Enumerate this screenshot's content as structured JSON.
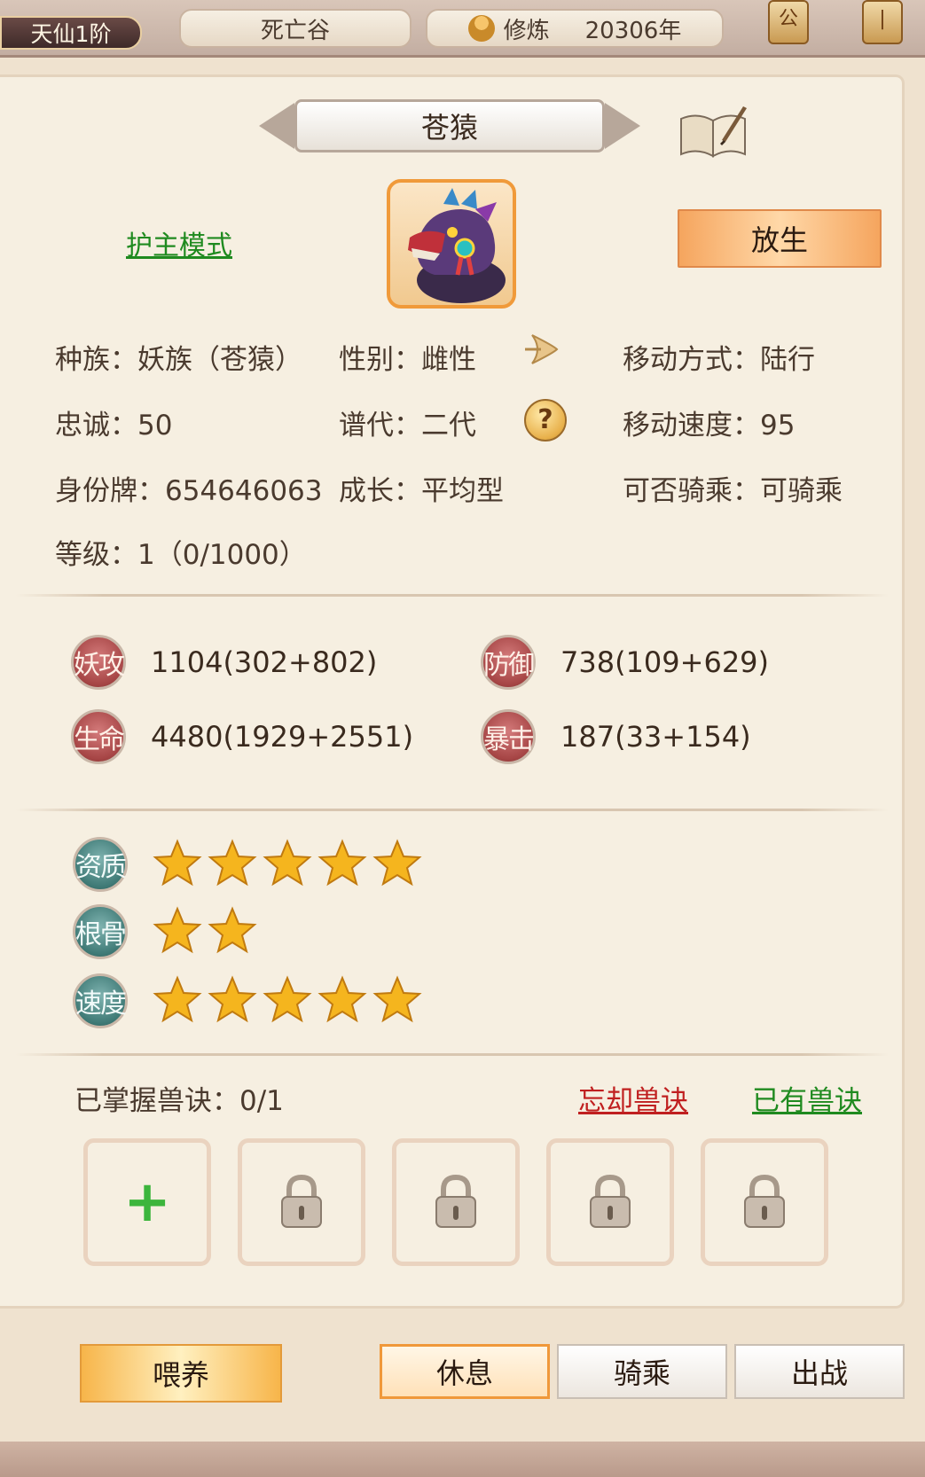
{
  "top_bar": {
    "realm": "天仙1阶",
    "location": "死亡谷",
    "cultivation_label": "修炼",
    "cultivation_years": "20306年",
    "lantern_1": "公",
    "lantern_2": "|"
  },
  "pet": {
    "name": "苍猿",
    "guard_mode_link": "护主模式",
    "release_button": "放生"
  },
  "info": {
    "race": "种族：妖族（苍猿）",
    "gender": "性别：雌性",
    "move_mode": "移动方式：陆行",
    "loyalty": "忠诚：50",
    "generation": "谱代：二代",
    "move_speed": "移动速度：95",
    "id_tag": "身份牌：654646063",
    "growth": "成长：平均型",
    "rideable": "可否骑乘：可骑乘",
    "level": "等级：1（0/1000）"
  },
  "stats": [
    {
      "label": "妖攻",
      "value": "1104(302+802)"
    },
    {
      "label": "防御",
      "value": "738(109+629)"
    },
    {
      "label": "生命",
      "value": "4480(1929+2551)"
    },
    {
      "label": "暴击",
      "value": "187(33+154)"
    }
  ],
  "attributes": [
    {
      "label": "资质",
      "stars": 5
    },
    {
      "label": "根骨",
      "stars": 2
    },
    {
      "label": "速度",
      "stars": 5
    }
  ],
  "skills": {
    "mastered_label": "已掌握兽诀：0/1",
    "forget_link": "忘却兽诀",
    "owned_link": "已有兽诀",
    "slots": [
      "add",
      "locked",
      "locked",
      "locked",
      "locked"
    ]
  },
  "actions": {
    "feed": "喂养",
    "rest": "休息",
    "ride": "骑乘",
    "battle": "出战",
    "active_mode": "rest"
  },
  "colors": {
    "link_green": "#1f8a1f",
    "link_red": "#c02020",
    "accent_orange": "#f0983a",
    "stat_badge": "#a64545",
    "attr_badge": "#3f7a76",
    "star": "#f5b51e"
  },
  "icons": {
    "portrait": "dragon-beast-portrait",
    "book": "book-quill-icon",
    "help": "question-icon",
    "arrow": "arrow-right-icon",
    "lock": "lock-icon",
    "plus": "plus-icon"
  }
}
